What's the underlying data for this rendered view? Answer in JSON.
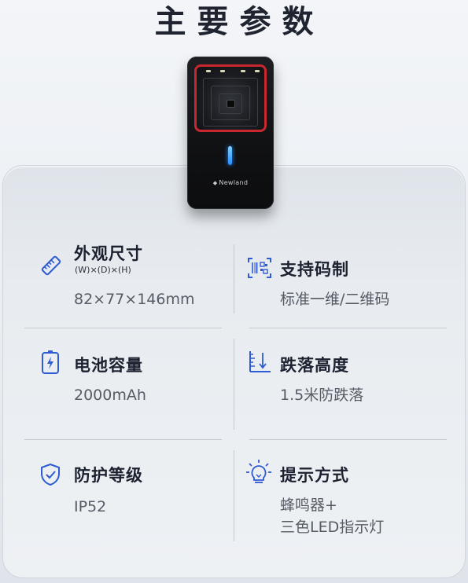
{
  "header": {
    "title": "主要参数"
  },
  "product": {
    "logo_text": "Newland"
  },
  "specs": {
    "dimensions": {
      "icon": "ruler-icon",
      "title": "外观尺寸",
      "subtitle": "(W)×(D)×(H)",
      "value": "82×77×146mm"
    },
    "barcode": {
      "icon": "barcode-scan-icon",
      "title": "支持码制",
      "value": "标准一维/二维码"
    },
    "battery": {
      "icon": "battery-icon",
      "title": "电池容量",
      "value": "2000mAh"
    },
    "drop": {
      "icon": "drop-height-icon",
      "title": "跌落高度",
      "value": "1.5米防跌落"
    },
    "protection": {
      "icon": "shield-check-icon",
      "title": "防护等级",
      "value": "IP52"
    },
    "indicator": {
      "icon": "lightbulb-icon",
      "title": "提示方式",
      "value_line1": "蜂鸣器+",
      "value_line2": "三色LED指示灯"
    }
  },
  "colors": {
    "accent_blue": "#2f5bd3",
    "title_text": "#1c2130",
    "value_text": "#565c66",
    "device_red": "#c8272f"
  }
}
